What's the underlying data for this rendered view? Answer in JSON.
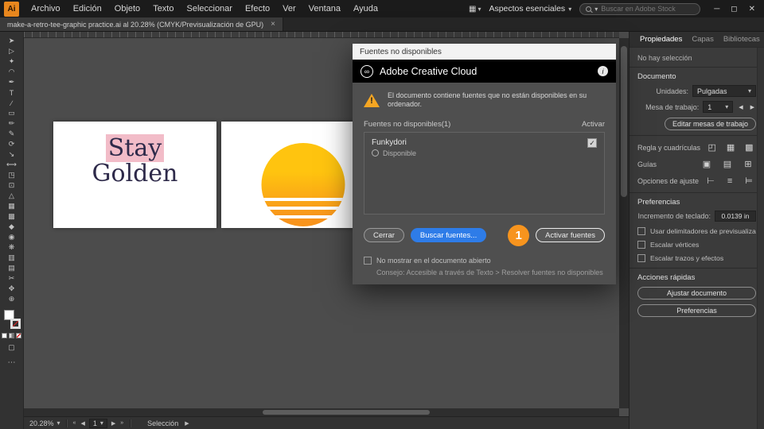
{
  "icons": {
    "caret": "▾",
    "minimize": "─",
    "restore": "◻",
    "close": "✕",
    "tab_close": "×",
    "prev": "◀",
    "next": "▶",
    "first": "«",
    "last": "»",
    "check": "✓",
    "warning_mark": "!",
    "info": "i",
    "cc_logo": "∞",
    "arrange": "▦",
    "ellipsis": "⋯",
    "draw_mode": "▢"
  },
  "menubar": {
    "app_icon": "Ai",
    "menus": [
      "Archivo",
      "Edición",
      "Objeto",
      "Texto",
      "Seleccionar",
      "Efecto",
      "Ver",
      "Ventana",
      "Ayuda"
    ],
    "workspace": "Aspectos esenciales",
    "search_placeholder": "Buscar en Adobe Stock"
  },
  "tabbar": {
    "doc_title": "make-a-retro-tee-graphic practice.ai al 20.28% (CMYK/Previsualización de GPU)"
  },
  "toolbar": {
    "tools": [
      {
        "name": "selection",
        "glyph": "➤"
      },
      {
        "name": "direct-selection",
        "glyph": "▷"
      },
      {
        "name": "magic-wand",
        "glyph": "✦"
      },
      {
        "name": "lasso",
        "glyph": "◠"
      },
      {
        "name": "pen",
        "glyph": "✒"
      },
      {
        "name": "type",
        "glyph": "T"
      },
      {
        "name": "line-segment",
        "glyph": "∕"
      },
      {
        "name": "rectangle",
        "glyph": "▭"
      },
      {
        "name": "paintbrush",
        "glyph": "✏"
      },
      {
        "name": "pencil",
        "glyph": "✎"
      },
      {
        "name": "rotate",
        "glyph": "⟳"
      },
      {
        "name": "scale",
        "glyph": "↘"
      },
      {
        "name": "width",
        "glyph": "⟷"
      },
      {
        "name": "free-transform",
        "glyph": "◳"
      },
      {
        "name": "shape-builder",
        "glyph": "⊡"
      },
      {
        "name": "perspective-grid",
        "glyph": "△"
      },
      {
        "name": "mesh",
        "glyph": "▦"
      },
      {
        "name": "gradient",
        "glyph": "▩"
      },
      {
        "name": "eyedropper",
        "glyph": "◆"
      },
      {
        "name": "blend",
        "glyph": "◉"
      },
      {
        "name": "symbol-sprayer",
        "glyph": "❋"
      },
      {
        "name": "column-graph",
        "glyph": "▥"
      },
      {
        "name": "artboard",
        "glyph": "▤"
      },
      {
        "name": "slice",
        "glyph": "✂"
      },
      {
        "name": "hand",
        "glyph": "✥"
      },
      {
        "name": "zoom",
        "glyph": "⊕"
      }
    ]
  },
  "canvas": {
    "artboard1": {
      "line1": "Stay",
      "line2": "Golden"
    }
  },
  "dialog": {
    "title": "Fuentes no disponibles",
    "brand": "Adobe Creative Cloud",
    "warning": "El documento contiene fuentes que no están disponibles en su ordenador.",
    "list_header": "Fuentes no disponibles(1)",
    "activate_col": "Activar",
    "font_name": "Funkydori",
    "font_status": "Disponible",
    "close_btn": "Cerrar",
    "find_btn": "Buscar fuentes...",
    "activate_btn": "Activar fuentes",
    "annotation": "1",
    "dont_show": "No mostrar en el documento abierto",
    "tip": "Consejo: Accesible a través de Texto > Resolver fuentes no disponibles"
  },
  "panel": {
    "tabs": [
      "Propiedades",
      "Capas",
      "Bibliotecas"
    ],
    "no_selection": "No hay selección",
    "document": {
      "title": "Documento",
      "units_label": "Unidades:",
      "units_value": "Pulgadas",
      "artboard_label": "Mesa de trabajo:",
      "artboard_value": "1",
      "edit_button": "Editar mesas de trabajo",
      "ruler_label": "Regla y cuadrículas",
      "ruler_icons": [
        "◰",
        "▦",
        "▩"
      ],
      "guides_label": "Guías",
      "guides_icons": [
        "▣",
        "▤",
        "⊞"
      ],
      "snap_label": "Opciones de ajuste",
      "snap_icons": [
        "⊢",
        "≡",
        "⊨"
      ]
    },
    "preferences": {
      "title": "Preferencias",
      "keyboard_label": "Incremento de teclado:",
      "keyboard_value": "0.0139 in",
      "checks": [
        "Usar delimitadores de previsualización",
        "Escalar vértices",
        "Escalar trazos y efectos"
      ]
    },
    "quick": {
      "title": "Acciones rápidas",
      "fit_button": "Ajustar documento",
      "prefs_button": "Preferencias"
    }
  },
  "statusbar": {
    "zoom": "20.28%",
    "artboard": "1",
    "tool": "Selección"
  },
  "colors": {
    "accent_blue": "#2E7CE8",
    "annotation_orange": "#F7941E",
    "warning_yellow": "#F5A623",
    "sun_top": "#FFC40F",
    "sun_bottom": "#F8941C",
    "highlight_pink": "#F2BCC8",
    "headline_navy": "#2E2A4A",
    "app_icon_orange": "#E8871E"
  }
}
